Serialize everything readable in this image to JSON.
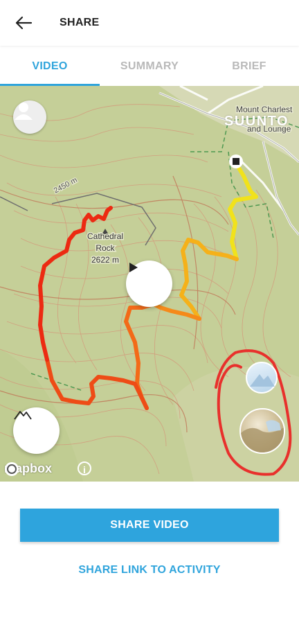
{
  "header": {
    "title": "SHARE",
    "back_icon": "arrow-left-icon"
  },
  "tabs": [
    {
      "label": "VIDEO",
      "active": true
    },
    {
      "label": "SUMMARY",
      "active": false
    },
    {
      "label": "BRIEF",
      "active": false
    }
  ],
  "map": {
    "brand": "SUUNTO",
    "place_label": "Mount Charleston Resort Lodge",
    "place_lines": [
      "Mount Charlest",
      "nt",
      "and Lounge"
    ],
    "peak_name_1": "Cathedral",
    "peak_name_2": "Rock",
    "peak_elevation": "2622 m",
    "contour_label": "2450 m",
    "attribution": "mapbox",
    "info_glyph": "i",
    "colors": {
      "route_start": "#f0e020",
      "route_end": "#ee2a12",
      "accent": "#2fa4dc"
    }
  },
  "actions": {
    "share_video": "SHARE VIDEO",
    "share_link": "SHARE LINK TO ACTIVITY"
  }
}
